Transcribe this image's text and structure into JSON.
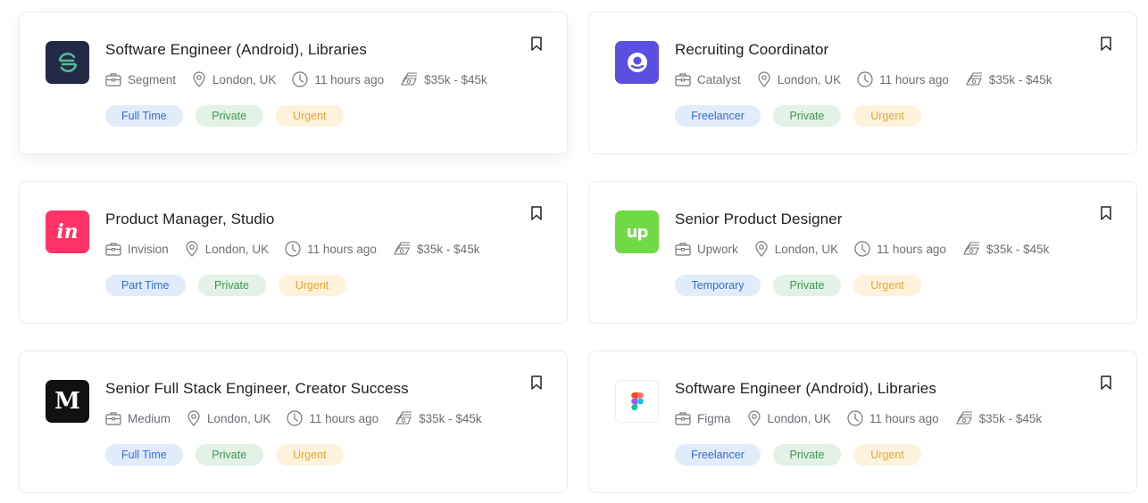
{
  "jobs": [
    {
      "title": "Software Engineer (Android), Libraries",
      "company": "Segment",
      "location": "London, UK",
      "posted": "11 hours ago",
      "salary": "$35k - $45k",
      "tags": [
        "Full Time",
        "Private",
        "Urgent"
      ],
      "logo": {
        "name": "segment-logo",
        "bg": "#232a45"
      }
    },
    {
      "title": "Recruiting Coordinator",
      "company": "Catalyst",
      "location": "London, UK",
      "posted": "11 hours ago",
      "salary": "$35k - $45k",
      "tags": [
        "Freelancer",
        "Private",
        "Urgent"
      ],
      "logo": {
        "name": "catalyst-logo",
        "bg": "#5a4fe0"
      }
    },
    {
      "title": "Product Manager, Studio",
      "company": "Invision",
      "location": "London, UK",
      "posted": "11 hours ago",
      "salary": "$35k - $45k",
      "tags": [
        "Part Time",
        "Private",
        "Urgent"
      ],
      "logo": {
        "name": "invision-logo",
        "bg": "#ff3366",
        "text": "in"
      }
    },
    {
      "title": "Senior Product Designer",
      "company": "Upwork",
      "location": "London, UK",
      "posted": "11 hours ago",
      "salary": "$35k - $45k",
      "tags": [
        "Temporary",
        "Private",
        "Urgent"
      ],
      "logo": {
        "name": "upwork-logo",
        "bg": "#6fda44",
        "text": "Up"
      }
    },
    {
      "title": "Senior Full Stack Engineer, Creator Success",
      "company": "Medium",
      "location": "London, UK",
      "posted": "11 hours ago",
      "salary": "$35k - $45k",
      "tags": [
        "Full Time",
        "Private",
        "Urgent"
      ],
      "logo": {
        "name": "medium-logo",
        "bg": "#111111",
        "text": "M"
      }
    },
    {
      "title": "Software Engineer (Android), Libraries",
      "company": "Figma",
      "location": "London, UK",
      "posted": "11 hours ago",
      "salary": "$35k - $45k",
      "tags": [
        "Freelancer",
        "Private",
        "Urgent"
      ],
      "logo": {
        "name": "figma-logo",
        "bg": "#ffffff"
      }
    }
  ],
  "icons": {
    "company": "briefcase-icon",
    "location": "map-pin-icon",
    "posted": "clock-icon",
    "salary": "money-icon",
    "bookmark": "bookmark-icon"
  },
  "colors": {
    "tag_type_bg": "#e1ebfa",
    "tag_type_text": "#2f6fd6",
    "tag_private_bg": "#e3f1e6",
    "tag_private_text": "#3a9a4e",
    "tag_urgent_bg": "#fdf2dc",
    "tag_urgent_text": "#f0a52b"
  }
}
